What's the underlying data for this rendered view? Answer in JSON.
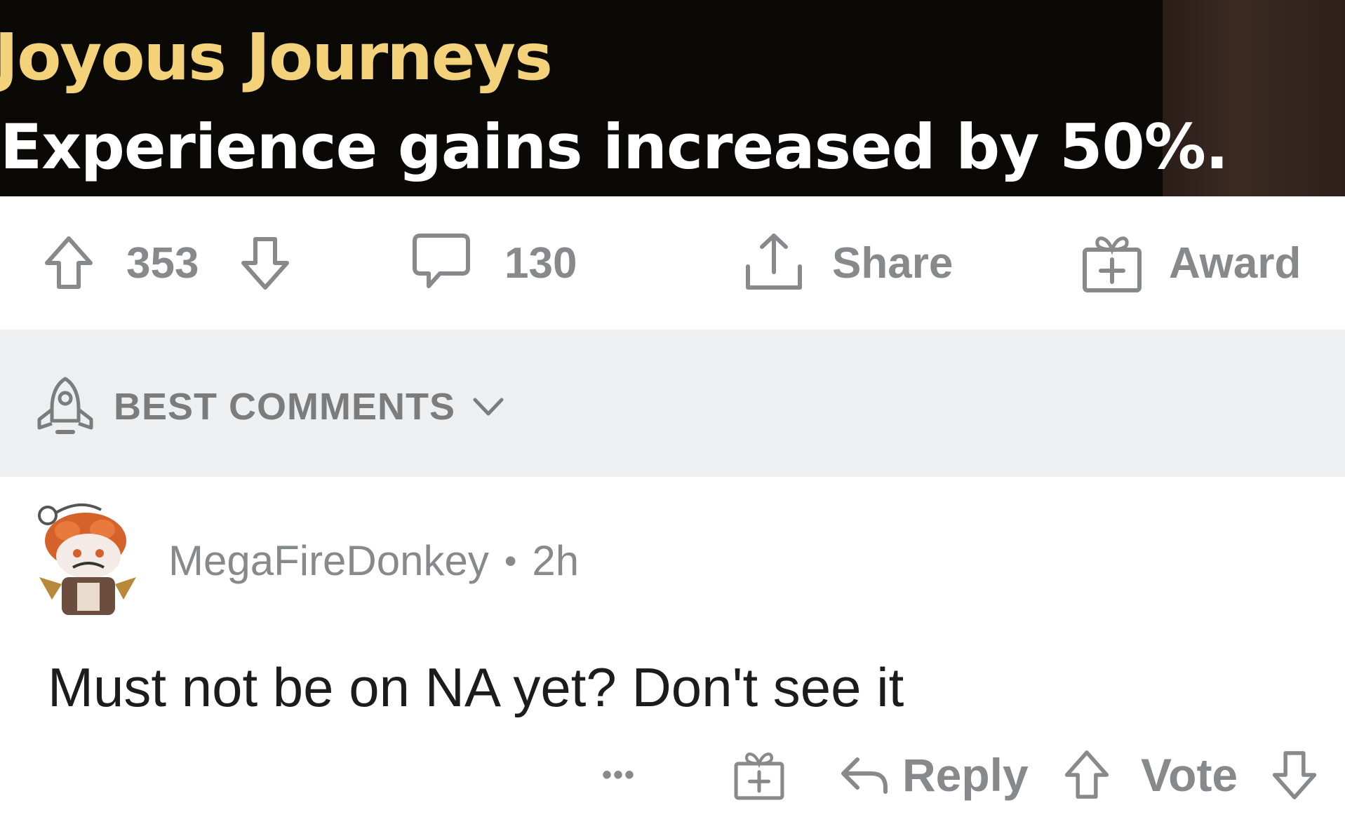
{
  "banner": {
    "title": "Joyous Journeys",
    "description": "Experience gains increased by 50%.",
    "title_color": "#f4d27a"
  },
  "post_actions": {
    "vote_count": "353",
    "comment_count": "130",
    "share_label": "Share",
    "award_label": "Award"
  },
  "sort": {
    "label": "BEST COMMENTS",
    "icon": "rocket-icon"
  },
  "comment": {
    "author": "MegaFireDonkey",
    "separator": "•",
    "time": "2h",
    "body": "Must not be on NA yet? Don't see it",
    "more_label": "•••",
    "reply_label": "Reply",
    "vote_label": "Vote"
  },
  "colors": {
    "muted_text": "#878a8c",
    "sort_bar_bg": "#edeff1",
    "banner_bg": "#0b0906"
  }
}
